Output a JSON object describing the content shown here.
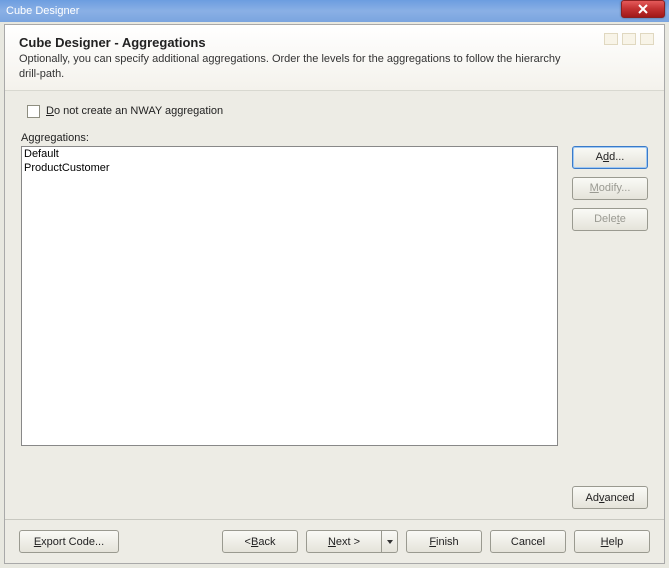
{
  "titlebar": {
    "title": "Cube Designer"
  },
  "header": {
    "title": "Cube Designer - Aggregations",
    "desc": "Optionally, you can specify additional aggregations. Order the levels for the aggregations to follow the hierarchy drill-path."
  },
  "checkbox": {
    "pre": "D",
    "rest": "o not create an NWAY aggregation"
  },
  "list": {
    "label": "Aggregations:",
    "items": [
      "Default",
      "ProductCustomer"
    ]
  },
  "side": {
    "add_pre": "A",
    "add_u": "d",
    "add_post": "d...",
    "modify_u": "M",
    "modify_post": "odify...",
    "delete_pre": "Dele",
    "delete_u": "t",
    "delete_post": "e"
  },
  "advanced": {
    "pre": "Ad",
    "u": "v",
    "post": "anced"
  },
  "footer": {
    "export_u": "E",
    "export_post": "xport Code...",
    "back_pre": "< ",
    "back_u": "B",
    "back_post": "ack",
    "next_u": "N",
    "next_post": "ext >",
    "finish_u": "F",
    "finish_post": "inish",
    "cancel": "Cancel",
    "help_u": "H",
    "help_post": "elp"
  }
}
